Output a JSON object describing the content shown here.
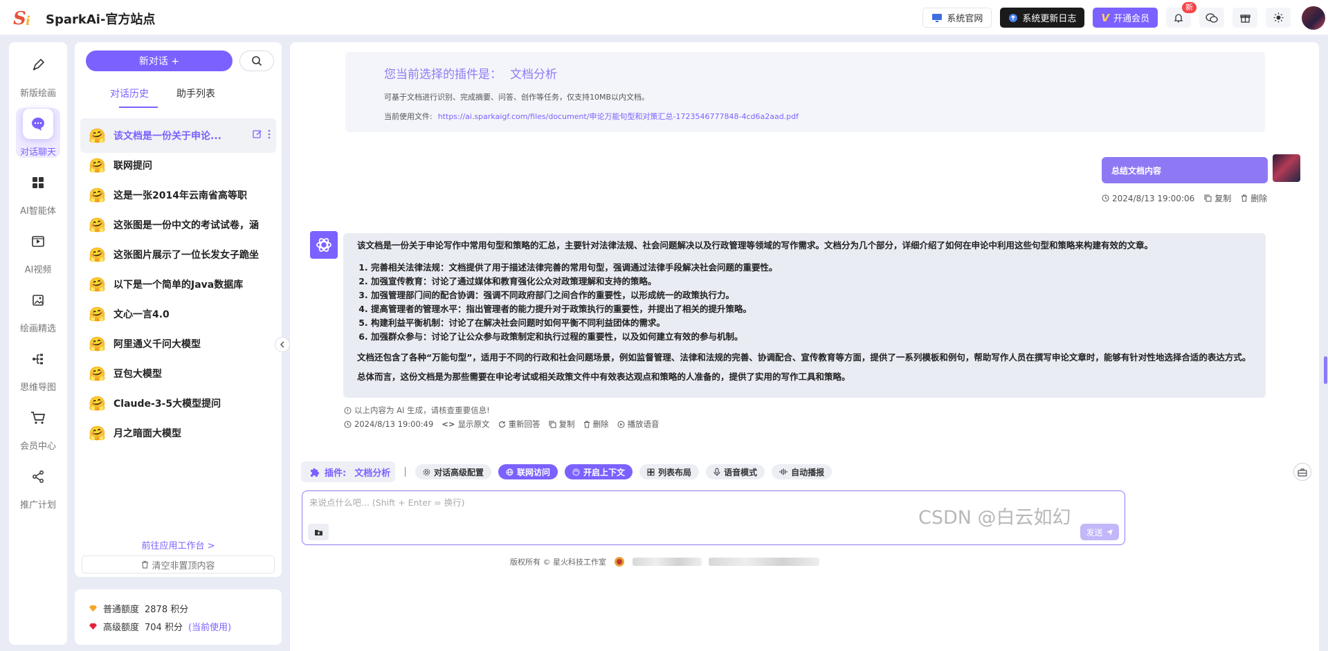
{
  "header": {
    "brand": "SparkAi-官方站点",
    "buttons": {
      "official_site": "系统官网",
      "changelog": "系统更新日志",
      "membership": "开通会员"
    },
    "notif_badge": "新"
  },
  "rail": [
    {
      "label": "新版绘画",
      "icon": "pen-icon"
    },
    {
      "label": "对话聊天",
      "icon": "chat-icon"
    },
    {
      "label": "AI智能体",
      "icon": "grid-icon"
    },
    {
      "label": "AI视频",
      "icon": "video-icon"
    },
    {
      "label": "绘画精选",
      "icon": "image-icon"
    },
    {
      "label": "思维导图",
      "icon": "mindmap-icon"
    },
    {
      "label": "会员中心",
      "icon": "cart-icon"
    },
    {
      "label": "推广计划",
      "icon": "share-icon"
    }
  ],
  "history": {
    "new_chat": "新对话 +",
    "tabs": [
      "对话历史",
      "助手列表"
    ],
    "items": [
      "该文档是一份关于申论...",
      "联网提问",
      "这是一张2014年云南省高等职",
      "这张图是一份中文的考试试卷，涵",
      "这张图片展示了一位长发女子跪坐",
      "以下是一个简单的Java数据库",
      "文心一言4.0",
      "阿里通义千问大模型",
      "豆包大模型",
      "Claude-3-5大模型提问",
      "月之暗面大模型"
    ],
    "goto_link": "前往应用工作台 >",
    "clear": "清空非置顶内容"
  },
  "quota": {
    "normal_label": "普通额度",
    "normal_value": "2878 积分",
    "advanced_label": "高级额度",
    "advanced_value": "704 积分",
    "advanced_note": "(当前使用)"
  },
  "plugin_card": {
    "title": "您当前选择的插件是：",
    "plugin_name": "文档分析",
    "description": "可基于文档进行识别、完成摘要、问答、创作等任务，仅支持10MB以内文档。",
    "file_label": "当前使用文件:",
    "file_url": "https://ai.sparkaigf.com/files/document/申论万能句型和对策汇总-1723546777848-4cd6a2aad.pdf"
  },
  "user_message": {
    "text": "总结文档内容",
    "time": "2024/8/13 19:00:06",
    "copy": "复制",
    "delete": "删除"
  },
  "bot_message": {
    "intro": "该文档是一份关于申论写作中常用句型和策略的汇总，主要针对法律法规、社会问题解决以及行政管理等领域的写作需求。文档分为几个部分，详细介绍了如何在申论中利用这些句型和策略来构建有效的文章。",
    "points": [
      "完善相关法律法规：文档提供了用于描述法律完善的常用句型，强调通过法律手段解决社会问题的重要性。",
      "加强宣传教育：讨论了通过媒体和教育强化公众对政策理解和支持的策略。",
      "加强管理部门间的配合协调：强调不同政府部门之间合作的重要性，以形成统一的政策执行力。",
      "提高管理者的管理水平：指出管理者的能力提升对于政策执行的重要性，并提出了相关的提升策略。",
      "构建利益平衡机制：讨论了在解决社会问题时如何平衡不同利益团体的需求。",
      "加强群众参与：讨论了让公众参与政策制定和执行过程的重要性，以及如何建立有效的参与机制。"
    ],
    "para2": "文档还包含了各种“万能句型”，适用于不同的行政和社会问题场景，例如监督管理、法律和法规的完善、协调配合、宣传教育等方面，提供了一系列模板和例句，帮助写作人员在撰写申论文章时，能够有针对性地选择合适的表达方式。",
    "para3": "总体而言，这份文档是为那些需要在申论考试或相关政策文件中有效表达观点和策略的人准备的，提供了实用的写作工具和策略。",
    "ai_note": "以上内容为 AI 生成，请核查重要信息!",
    "time": "2024/8/13 19:00:49",
    "actions": [
      "显示原文",
      "重新回答",
      "复制",
      "删除",
      "播放语音"
    ]
  },
  "toolbar": {
    "plugin_label": "插件:",
    "plugin_name": "文档分析",
    "chips": [
      {
        "label": "对话高级配置",
        "active": false,
        "icon": "settings-icon"
      },
      {
        "label": "联网访问",
        "active": true,
        "icon": "globe-icon"
      },
      {
        "label": "开启上下文",
        "active": true,
        "icon": "context-icon"
      },
      {
        "label": "列表布局",
        "active": false,
        "icon": "layout-icon"
      },
      {
        "label": "语音模式",
        "active": false,
        "icon": "mic-icon"
      },
      {
        "label": "自动播报",
        "active": false,
        "icon": "audio-icon"
      }
    ]
  },
  "input": {
    "placeholder": "来说点什么吧... (Shift + Enter = 换行)",
    "send": "发送"
  },
  "footer": {
    "copyright": "版权所有 © 星火科技工作室"
  },
  "watermark": "CSDN @白云如幻",
  "colors": {
    "accent": "#7b61ff",
    "accent_light": "#8f78f4",
    "background": "#e9ecf5"
  }
}
